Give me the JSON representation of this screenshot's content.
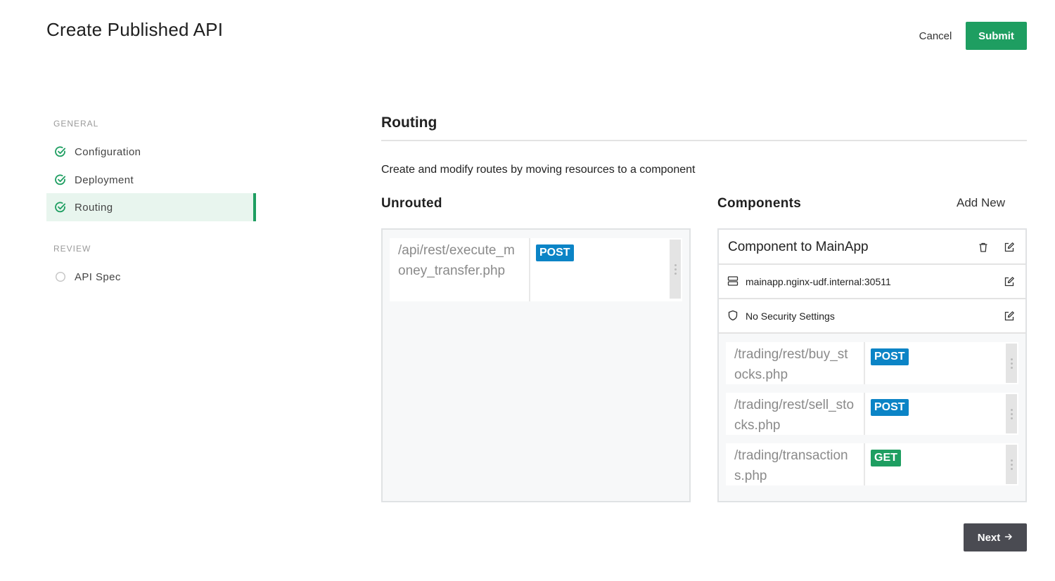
{
  "header": {
    "title": "Create Published API",
    "cancel_label": "Cancel",
    "submit_label": "Submit"
  },
  "sidebar": {
    "sections": [
      {
        "label": "GENERAL",
        "items": [
          {
            "label": "Configuration",
            "status": "complete"
          },
          {
            "label": "Deployment",
            "status": "complete"
          },
          {
            "label": "Routing",
            "status": "complete",
            "active": true
          }
        ]
      },
      {
        "label": "REVIEW",
        "items": [
          {
            "label": "API Spec",
            "status": "incomplete"
          }
        ]
      }
    ]
  },
  "main": {
    "title": "Routing",
    "description": "Create and modify routes by moving resources to a component",
    "unrouted": {
      "title": "Unrouted",
      "routes": [
        {
          "path": "/api/rest/execute_money_transfer.php",
          "method": "POST"
        }
      ]
    },
    "components": {
      "title": "Components",
      "add_new_label": "Add New",
      "items": [
        {
          "name": "Component to MainApp",
          "upstream": "mainapp.nginx-udf.internal:30511",
          "security": "No Security Settings",
          "routes": [
            {
              "path": "/trading/rest/buy_stocks.php",
              "method": "POST"
            },
            {
              "path": "/trading/rest/sell_stocks.php",
              "method": "POST"
            },
            {
              "path": "/trading/transactions.php",
              "method": "GET"
            }
          ]
        }
      ]
    },
    "next_label": "Next"
  },
  "colors": {
    "accent": "#1e9e61",
    "post": "#0b84c6",
    "get": "#1e9e61",
    "next_button": "#4a4b52"
  },
  "icons": {
    "complete": "check-circle-icon",
    "incomplete": "empty-circle-icon",
    "delete": "trash-icon",
    "edit": "edit-icon",
    "server": "server-icon",
    "security": "shield-icon",
    "next": "arrow-right-icon"
  }
}
